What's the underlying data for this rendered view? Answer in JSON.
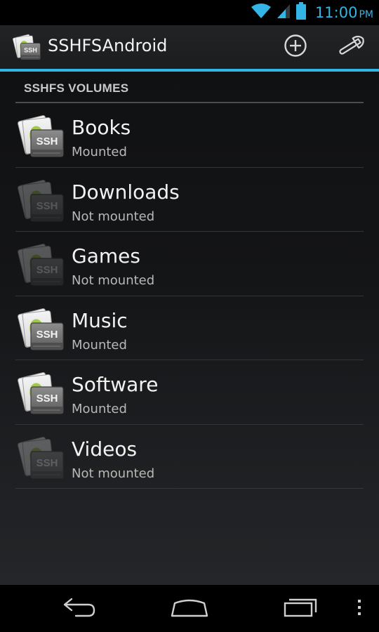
{
  "status_bar": {
    "time": "11:00",
    "ampm": "PM",
    "icons": [
      "wifi-icon",
      "cell-signal-icon",
      "battery-icon"
    ],
    "accent_color": "#33b5e5"
  },
  "action_bar": {
    "title": "SSHFSAndroid",
    "app_icon": "ssh-drive-icon",
    "actions": [
      {
        "name": "add-volume-button",
        "icon": "add-circle-icon"
      },
      {
        "name": "settings-button",
        "icon": "wrench-icon"
      }
    ]
  },
  "section": {
    "header": "SSHFS VOLUMES"
  },
  "volumes": [
    {
      "name": "Books",
      "status": "Mounted",
      "mounted": true
    },
    {
      "name": "Downloads",
      "status": "Not mounted",
      "mounted": false
    },
    {
      "name": "Games",
      "status": "Not mounted",
      "mounted": false
    },
    {
      "name": "Music",
      "status": "Mounted",
      "mounted": true
    },
    {
      "name": "Software",
      "status": "Mounted",
      "mounted": true
    },
    {
      "name": "Videos",
      "status": "Not mounted",
      "mounted": false
    }
  ],
  "icon_label": "SSH",
  "nav_bar": {
    "buttons": [
      "back-icon",
      "home-icon",
      "recents-icon",
      "overflow-menu-icon"
    ]
  }
}
